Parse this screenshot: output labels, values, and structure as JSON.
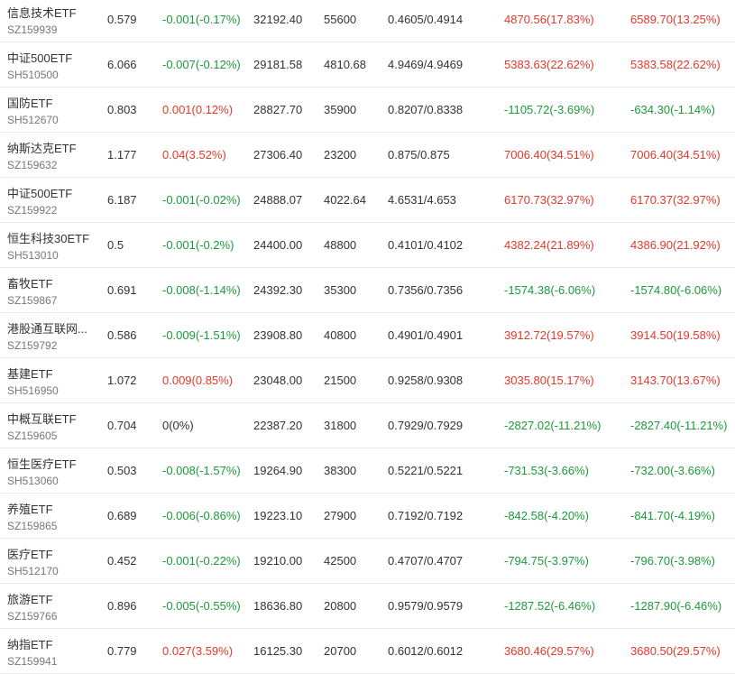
{
  "colors": {
    "up": "#e3392a",
    "down": "#1b9b3a",
    "neutral": "#333333"
  },
  "rows": [
    {
      "name": "信息技术ETF",
      "code": "SZ159939",
      "price": "0.579",
      "change": "-0.001(-0.17%)",
      "change_dir": "down",
      "amount": "32192.40",
      "shares": "55600",
      "nav": "0.4605/0.4914",
      "profit1": "4870.56(17.83%)",
      "profit1_dir": "up",
      "profit2": "6589.70(13.25%)",
      "profit2_dir": "up"
    },
    {
      "name": "中证500ETF",
      "code": "SH510500",
      "price": "6.066",
      "change": "-0.007(-0.12%)",
      "change_dir": "down",
      "amount": "29181.58",
      "shares": "4810.68",
      "nav": "4.9469/4.9469",
      "profit1": "5383.63(22.62%)",
      "profit1_dir": "up",
      "profit2": "5383.58(22.62%)",
      "profit2_dir": "up"
    },
    {
      "name": "国防ETF",
      "code": "SH512670",
      "price": "0.803",
      "change": "0.001(0.12%)",
      "change_dir": "up",
      "amount": "28827.70",
      "shares": "35900",
      "nav": "0.8207/0.8338",
      "profit1": "-1105.72(-3.69%)",
      "profit1_dir": "down",
      "profit2": "-634.30(-1.14%)",
      "profit2_dir": "down"
    },
    {
      "name": "纳斯达克ETF",
      "code": "SZ159632",
      "price": "1.177",
      "change": "0.04(3.52%)",
      "change_dir": "up",
      "amount": "27306.40",
      "shares": "23200",
      "nav": "0.875/0.875",
      "profit1": "7006.40(34.51%)",
      "profit1_dir": "up",
      "profit2": "7006.40(34.51%)",
      "profit2_dir": "up"
    },
    {
      "name": "中证500ETF",
      "code": "SZ159922",
      "price": "6.187",
      "change": "-0.001(-0.02%)",
      "change_dir": "down",
      "amount": "24888.07",
      "shares": "4022.64",
      "nav": "4.6531/4.653",
      "profit1": "6170.73(32.97%)",
      "profit1_dir": "up",
      "profit2": "6170.37(32.97%)",
      "profit2_dir": "up"
    },
    {
      "name": "恒生科技30ETF",
      "code": "SH513010",
      "price": "0.5",
      "change": "-0.001(-0.2%)",
      "change_dir": "down",
      "amount": "24400.00",
      "shares": "48800",
      "nav": "0.4101/0.4102",
      "profit1": "4382.24(21.89%)",
      "profit1_dir": "up",
      "profit2": "4386.90(21.92%)",
      "profit2_dir": "up"
    },
    {
      "name": "畜牧ETF",
      "code": "SZ159867",
      "price": "0.691",
      "change": "-0.008(-1.14%)",
      "change_dir": "down",
      "amount": "24392.30",
      "shares": "35300",
      "nav": "0.7356/0.7356",
      "profit1": "-1574.38(-6.06%)",
      "profit1_dir": "down",
      "profit2": "-1574.80(-6.06%)",
      "profit2_dir": "down"
    },
    {
      "name": "港股通互联网...",
      "code": "SZ159792",
      "price": "0.586",
      "change": "-0.009(-1.51%)",
      "change_dir": "down",
      "amount": "23908.80",
      "shares": "40800",
      "nav": "0.4901/0.4901",
      "profit1": "3912.72(19.57%)",
      "profit1_dir": "up",
      "profit2": "3914.50(19.58%)",
      "profit2_dir": "up"
    },
    {
      "name": "基建ETF",
      "code": "SH516950",
      "price": "1.072",
      "change": "0.009(0.85%)",
      "change_dir": "up",
      "amount": "23048.00",
      "shares": "21500",
      "nav": "0.9258/0.9308",
      "profit1": "3035.80(15.17%)",
      "profit1_dir": "up",
      "profit2": "3143.70(13.67%)",
      "profit2_dir": "up"
    },
    {
      "name": "中概互联ETF",
      "code": "SZ159605",
      "price": "0.704",
      "change": "0(0%)",
      "change_dir": "neutral",
      "amount": "22387.20",
      "shares": "31800",
      "nav": "0.7929/0.7929",
      "profit1": "-2827.02(-11.21%)",
      "profit1_dir": "down",
      "profit2": "-2827.40(-11.21%)",
      "profit2_dir": "down"
    },
    {
      "name": "恒生医疗ETF",
      "code": "SH513060",
      "price": "0.503",
      "change": "-0.008(-1.57%)",
      "change_dir": "down",
      "amount": "19264.90",
      "shares": "38300",
      "nav": "0.5221/0.5221",
      "profit1": "-731.53(-3.66%)",
      "profit1_dir": "down",
      "profit2": "-732.00(-3.66%)",
      "profit2_dir": "down"
    },
    {
      "name": "养殖ETF",
      "code": "SZ159865",
      "price": "0.689",
      "change": "-0.006(-0.86%)",
      "change_dir": "down",
      "amount": "19223.10",
      "shares": "27900",
      "nav": "0.7192/0.7192",
      "profit1": "-842.58(-4.20%)",
      "profit1_dir": "down",
      "profit2": "-841.70(-4.19%)",
      "profit2_dir": "down"
    },
    {
      "name": "医疗ETF",
      "code": "SH512170",
      "price": "0.452",
      "change": "-0.001(-0.22%)",
      "change_dir": "down",
      "amount": "19210.00",
      "shares": "42500",
      "nav": "0.4707/0.4707",
      "profit1": "-794.75(-3.97%)",
      "profit1_dir": "down",
      "profit2": "-796.70(-3.98%)",
      "profit2_dir": "down"
    },
    {
      "name": "旅游ETF",
      "code": "SZ159766",
      "price": "0.896",
      "change": "-0.005(-0.55%)",
      "change_dir": "down",
      "amount": "18636.80",
      "shares": "20800",
      "nav": "0.9579/0.9579",
      "profit1": "-1287.52(-6.46%)",
      "profit1_dir": "down",
      "profit2": "-1287.90(-6.46%)",
      "profit2_dir": "down"
    },
    {
      "name": "纳指ETF",
      "code": "SZ159941",
      "price": "0.779",
      "change": "0.027(3.59%)",
      "change_dir": "up",
      "amount": "16125.30",
      "shares": "20700",
      "nav": "0.6012/0.6012",
      "profit1": "3680.46(29.57%)",
      "profit1_dir": "up",
      "profit2": "3680.50(29.57%)",
      "profit2_dir": "up"
    }
  ]
}
